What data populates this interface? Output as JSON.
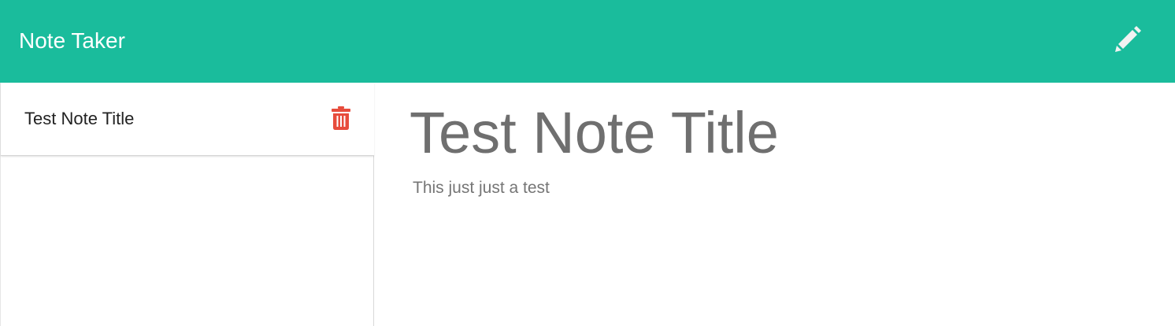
{
  "navbar": {
    "brand": "Note Taker",
    "new_note_icon": "pencil-icon",
    "background": "#1abc9c"
  },
  "sidebar": {
    "notes": [
      {
        "title": "Test Note Title",
        "delete_icon": "trash-icon",
        "delete_color": "#e74c3c"
      }
    ]
  },
  "editor": {
    "title": "Test Note Title",
    "text": "This just just a test"
  }
}
